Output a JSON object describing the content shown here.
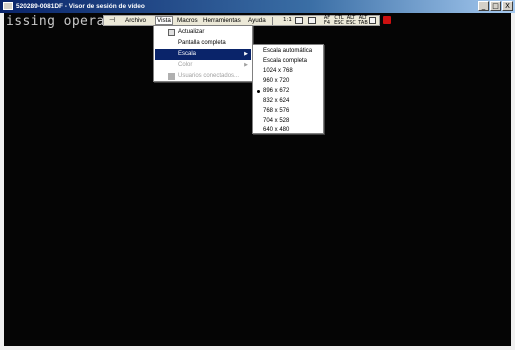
{
  "window": {
    "title": "520289-0081DF - Visor de sesión de vídeo",
    "controls": [
      "_",
      "□",
      "X"
    ]
  },
  "session": {
    "console_text": "issing operatin"
  },
  "menubar": {
    "pin_glyph": "⊣",
    "items": [
      "Archivo",
      "Vista",
      "Macros",
      "Herramientas",
      "Ayuda"
    ],
    "open_item": "Vista"
  },
  "toolbar_icons": {
    "scale": "1:1",
    "btn_a": "AF\nF4",
    "btn_b": "CTL\nESC",
    "btn_c": "ALT\nESC",
    "btn_d": "ALT\nTAB"
  },
  "vista_menu": {
    "items": [
      {
        "label": "Actualizar",
        "has_icon": true,
        "arrow": false,
        "disabled": false
      },
      {
        "label": "Pantalla completa",
        "has_icon": false,
        "arrow": false,
        "disabled": false
      },
      {
        "label": "Escala",
        "has_icon": false,
        "arrow": true,
        "disabled": false,
        "highlighted": true
      },
      {
        "label": "Color",
        "has_icon": false,
        "arrow": true,
        "disabled": true
      },
      {
        "label": "Usuarios conectados...",
        "has_icon": true,
        "arrow": false,
        "disabled": true
      }
    ]
  },
  "escala_submenu": {
    "items": [
      {
        "label": "Escala automática",
        "selected": false
      },
      {
        "label": "Escala completa",
        "selected": false
      },
      {
        "label": "1024 x 768",
        "selected": false
      },
      {
        "label": "960 x 720",
        "selected": false
      },
      {
        "label": "896 x 672",
        "selected": true
      },
      {
        "label": "832 x 624",
        "selected": false
      },
      {
        "label": "768 x 576",
        "selected": false
      },
      {
        "label": "704 x 528",
        "selected": false
      },
      {
        "label": "640 x 480",
        "selected": false
      }
    ]
  },
  "colors": {
    "titlebar": "#0a246a",
    "highlight": "#0a246a",
    "session_bg": "#050505"
  }
}
